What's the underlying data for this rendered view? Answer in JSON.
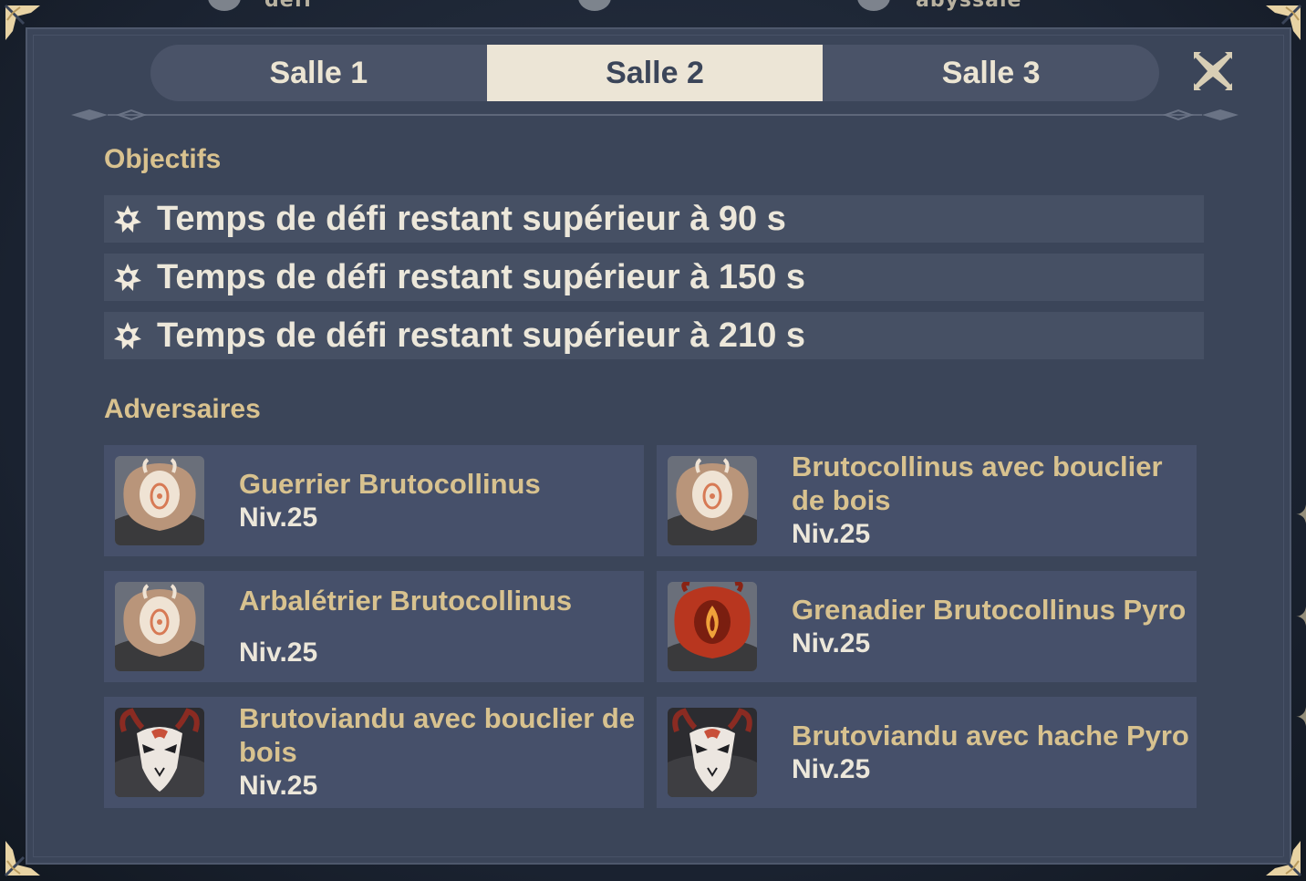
{
  "background": {
    "top_left_label": "défi",
    "top_right_label": "abyssale"
  },
  "tabs": [
    {
      "label": "Salle 1",
      "active": false
    },
    {
      "label": "Salle 2",
      "active": true
    },
    {
      "label": "Salle 3",
      "active": false
    }
  ],
  "objectives": {
    "title": "Objectifs",
    "items": [
      "Temps de défi restant supérieur à 90 s",
      "Temps de défi restant supérieur à 150 s",
      "Temps de défi restant supérieur à 210 s"
    ]
  },
  "adversaries": {
    "title": "Adversaires",
    "items": [
      {
        "name": "Guerrier Brutocollinus",
        "level": "Niv.25",
        "portrait": "hilichurl-mask-icon"
      },
      {
        "name": "Brutocollinus avec bouclier de bois",
        "level": "Niv.25",
        "portrait": "hilichurl-mask-icon"
      },
      {
        "name": "Arbalétrier Brutocollinus",
        "level": "Niv.25",
        "portrait": "hilichurl-mask-icon"
      },
      {
        "name": "Grenadier Brutocollinus Pyro",
        "level": "Niv.25",
        "portrait": "pyro-hilichurl-icon"
      },
      {
        "name": "Brutoviandu avec bouclier de bois",
        "level": "Niv.25",
        "portrait": "mitachurl-mask-icon"
      },
      {
        "name": "Brutoviandu avec hache Pyro",
        "level": "Niv.25",
        "portrait": "mitachurl-mask-icon"
      }
    ]
  },
  "colors": {
    "panel": "#3b4559",
    "accent_gold": "#d8c28f",
    "active_tab": "#ece5d6",
    "text_light": "#ece7da"
  }
}
